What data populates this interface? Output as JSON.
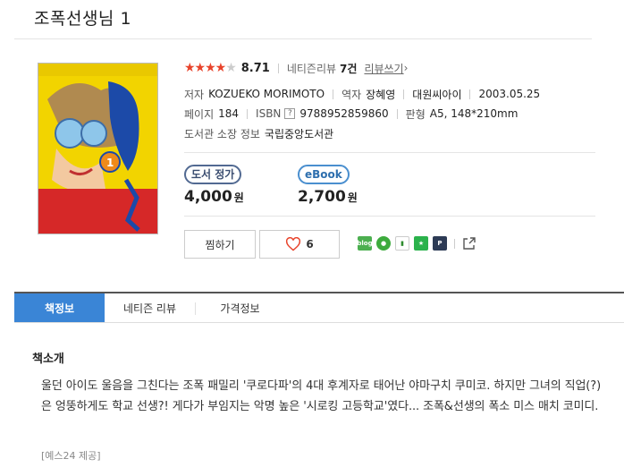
{
  "book": {
    "title": "조폭선생님 1",
    "rating": {
      "stars": 4.5,
      "score": "8.71",
      "review_label": "네티즌리뷰",
      "review_count": "7건",
      "write_review": "리뷰쓰기"
    },
    "author_label": "저자",
    "author": "KOZUEKO MORIMOTO",
    "translator_label": "역자",
    "translator": "장혜영",
    "publisher": "대원씨아이",
    "date": "2003.05.25",
    "pages_label": "페이지",
    "pages": "184",
    "isbn_label": "ISBN",
    "isbn_help": "?",
    "isbn": "9788952859860",
    "format_label": "판형",
    "format": "A5, 148*210mm",
    "library_label": "도서관 소장 정보",
    "library": "국립중앙도서관"
  },
  "prices": [
    {
      "badge": "도서 정가",
      "price": "4,000",
      "unit": "원"
    },
    {
      "badge": "eBook",
      "price": "2,700",
      "unit": "원"
    }
  ],
  "actions": {
    "wish": "찜하기",
    "like_count": "6"
  },
  "share": [
    "blog",
    "cafe",
    "book",
    "star",
    "pin"
  ],
  "tabs": [
    "책정보",
    "네티즌 리뷰",
    "가격정보"
  ],
  "intro": {
    "heading": "책소개",
    "text": "울던 아이도 울음을 그친다는 조폭 패밀리 '쿠로다파'의 4대 후계자로 태어난 야마구치 쿠미코. 하지만 그녀의 직업(?)은 엉뚱하게도 학교 선생?! 게다가 부임지는 악명 높은 '시로킹 고등학교'였다... 조폭&선생의 폭소 미스 매치 코미디.",
    "source": "[예스24 제공]"
  },
  "colors": {
    "accent": "#3a85d6",
    "star": "#e8432b",
    "like": "#e8432b"
  },
  "icons": {
    "like": "heart-icon",
    "share": "share-icon"
  }
}
